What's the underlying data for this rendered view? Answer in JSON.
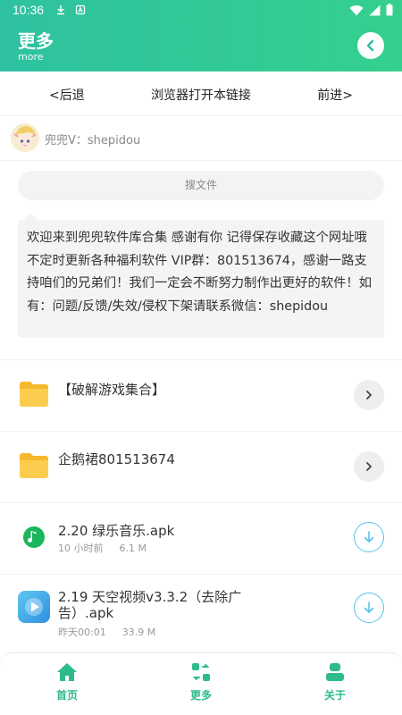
{
  "status_bar": {
    "time": "10:36"
  },
  "header": {
    "title": "更多",
    "subtitle": "more"
  },
  "nav": {
    "back": "<后退",
    "open_in_browser": "浏览器打开本链接",
    "forward": "前进>"
  },
  "user": {
    "name": "兜兜V：shepidou"
  },
  "search": {
    "placeholder": "搜文件"
  },
  "notice": {
    "text": "欢迎来到兜兜软件库合集 感谢有你 记得保存收藏这个网址哦 不定时更新各种福利软件 VIP群：801513674，感谢一路支持咱们的兄弟们！我们一定会不断努力制作出更好的软件！如有：问题/反馈/失效/侵权下架请联系微信：shepidou"
  },
  "items": [
    {
      "type": "folder",
      "title": "【破解游戏集合】"
    },
    {
      "type": "folder",
      "title": "企鹅裙801513674"
    },
    {
      "type": "file",
      "title": "2.20 绿乐音乐.apk",
      "time": "10 小时前",
      "size": "6.1 M"
    },
    {
      "type": "file",
      "title": "2.19 天空视频v3.3.2（去除广告）.apk",
      "time": "昨天00:01",
      "size": "33.9 M"
    }
  ],
  "tabs": [
    {
      "label": "首页"
    },
    {
      "label": "更多"
    },
    {
      "label": "关于"
    }
  ],
  "colors": {
    "primary": "#2ec1a1",
    "accent": "#35d08e",
    "download": "#57c1ec",
    "folder": "#f8c23a"
  }
}
